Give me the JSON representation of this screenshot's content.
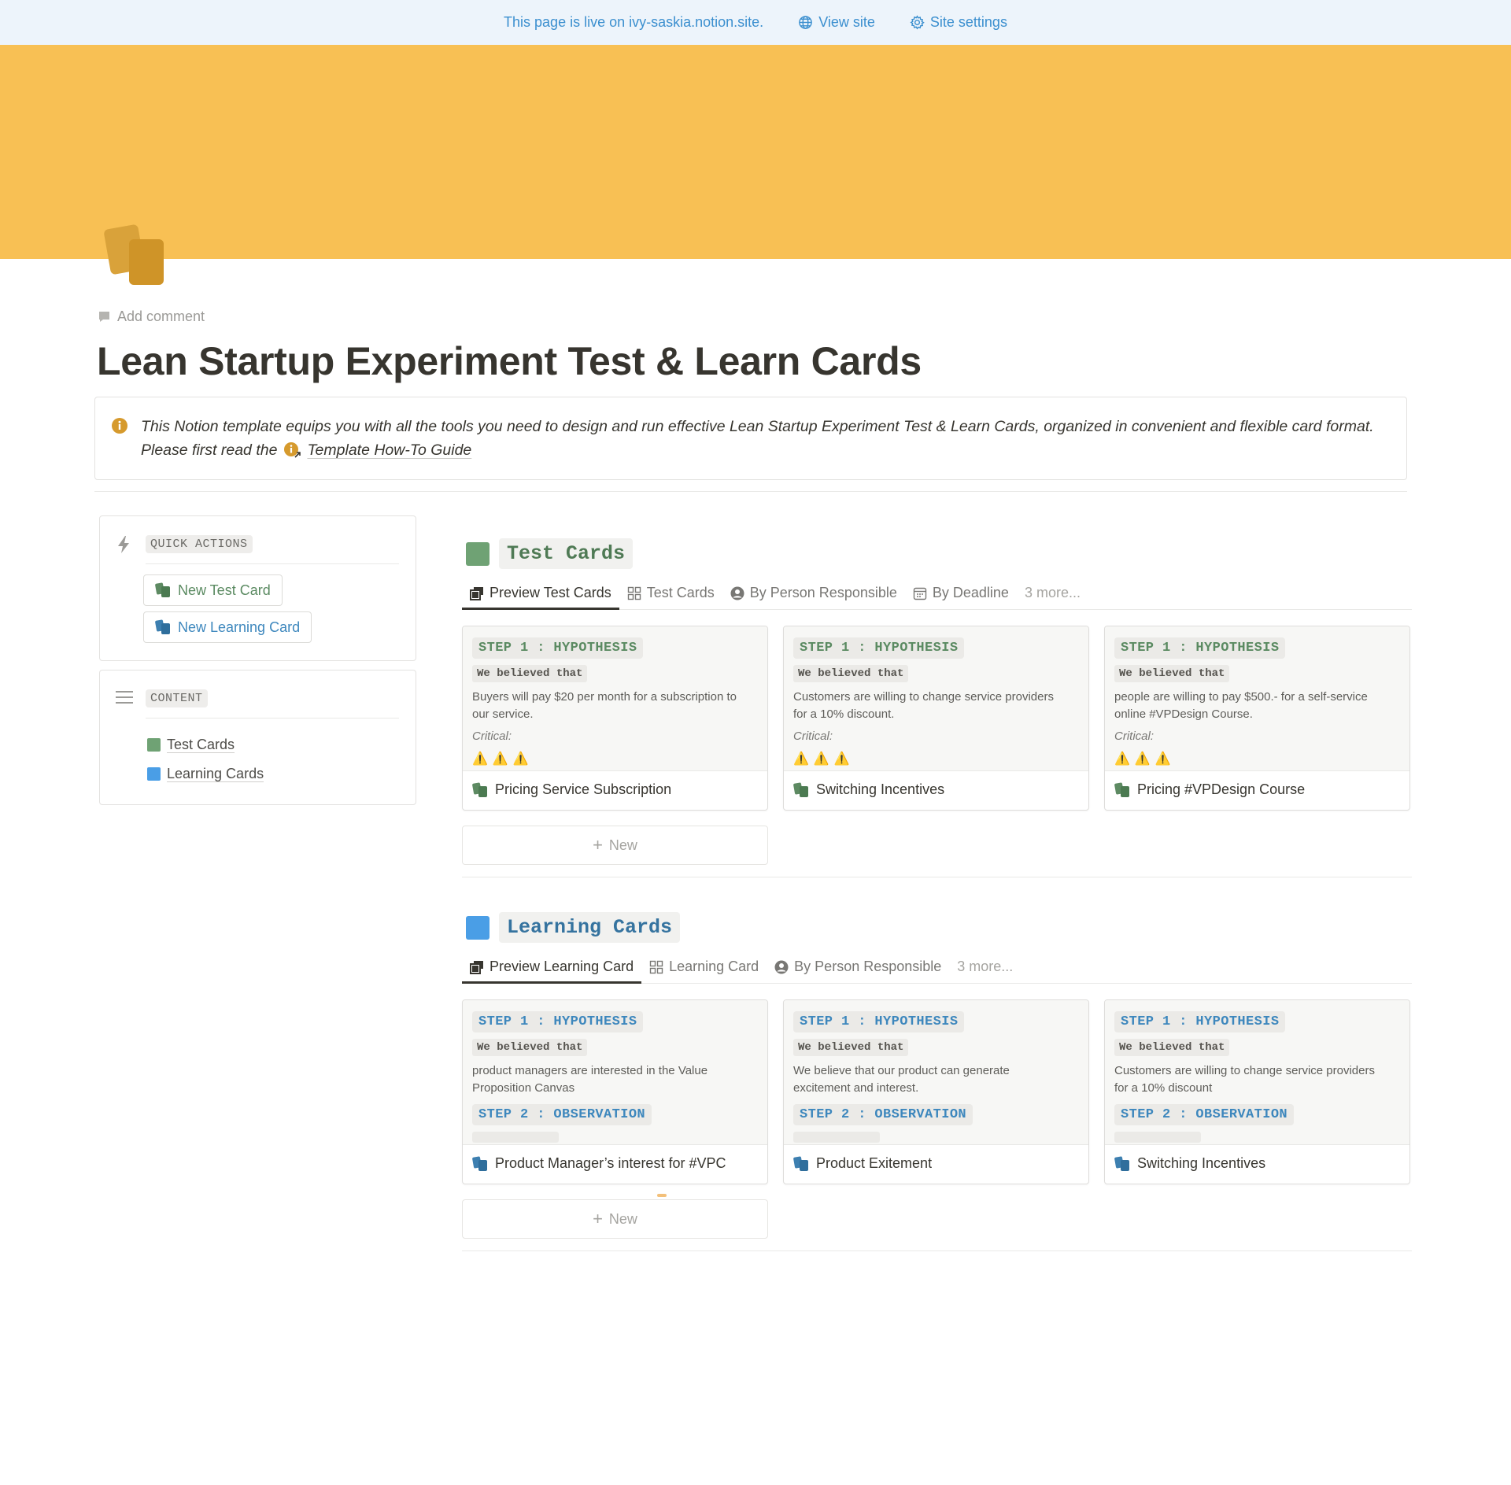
{
  "topbar": {
    "live_text": "This page is live on ivy-saskia.notion.site.",
    "view_site": "View site",
    "site_settings": "Site settings"
  },
  "colors": {
    "cover": "#f8c054",
    "accent_blue": "#3b8fcf",
    "test_green": "#6fa274",
    "learning_blue": "#4a9ee6"
  },
  "page": {
    "add_comment": "Add comment",
    "title": "Lean Startup Experiment Test & Learn Cards",
    "callout_line1": "This Notion template equips you with all the tools you need to design and run effective Lean Startup Experiment Test & Learn Cards, organized in convenient and flexible card format.",
    "callout_line2_prefix": "Please first read the",
    "callout_link": "Template How-To Guide"
  },
  "sidebar": {
    "quick_actions": {
      "heading": "QUICK ACTIONS",
      "buttons": [
        "New Test Card",
        "New Learning Card"
      ]
    },
    "content": {
      "heading": "CONTENT",
      "links": [
        "Test Cards",
        "Learning Cards"
      ]
    }
  },
  "test_section": {
    "title": "Test Cards",
    "tabs": [
      "Preview Test Cards",
      "Test Cards",
      "By Person Responsible",
      "By Deadline",
      "3 more..."
    ],
    "cards": [
      {
        "step": "STEP 1 : HYPOTHESIS",
        "believed": "We believed that",
        "body": "Buyers will pay $20 per month for a subscription to our service.",
        "critical": "Critical:",
        "name": "Pricing Service Subscription"
      },
      {
        "step": "STEP 1 : HYPOTHESIS",
        "believed": "We believed that",
        "body": "Customers are willing to change service providers for a 10% discount.",
        "critical": "Critical:",
        "name": "Switching Incentives"
      },
      {
        "step": "STEP 1 : HYPOTHESIS",
        "believed": "We believed that",
        "body": "people are willing to pay $500.- for a self-service online #VPDesign Course.",
        "critical": "Critical:",
        "name": "Pricing #VPDesign Course"
      }
    ],
    "new_label": "New"
  },
  "learning_section": {
    "title": "Learning Cards",
    "tabs": [
      "Preview Learning Card",
      "Learning Card",
      "By Person Responsible",
      "3 more..."
    ],
    "cards": [
      {
        "step": "STEP 1 : HYPOTHESIS",
        "believed": "We believed that",
        "body": "product managers are interested in the Value Proposition Canvas",
        "step2": "STEP 2 : OBSERVATION",
        "name": "Product Manager’s interest for #VPC"
      },
      {
        "step": "STEP 1 : HYPOTHESIS",
        "believed": "We believed that",
        "body": "We believe that our product can generate excitement and interest.",
        "step2": "STEP 2 : OBSERVATION",
        "name": "Product Exitement"
      },
      {
        "step": "STEP 1 : HYPOTHESIS",
        "believed": "We believed that",
        "body": "Customers are willing to change service providers for a 10% discount",
        "step2": "STEP 2 : OBSERVATION",
        "name": "Switching Incentives"
      }
    ],
    "new_label": "New"
  }
}
